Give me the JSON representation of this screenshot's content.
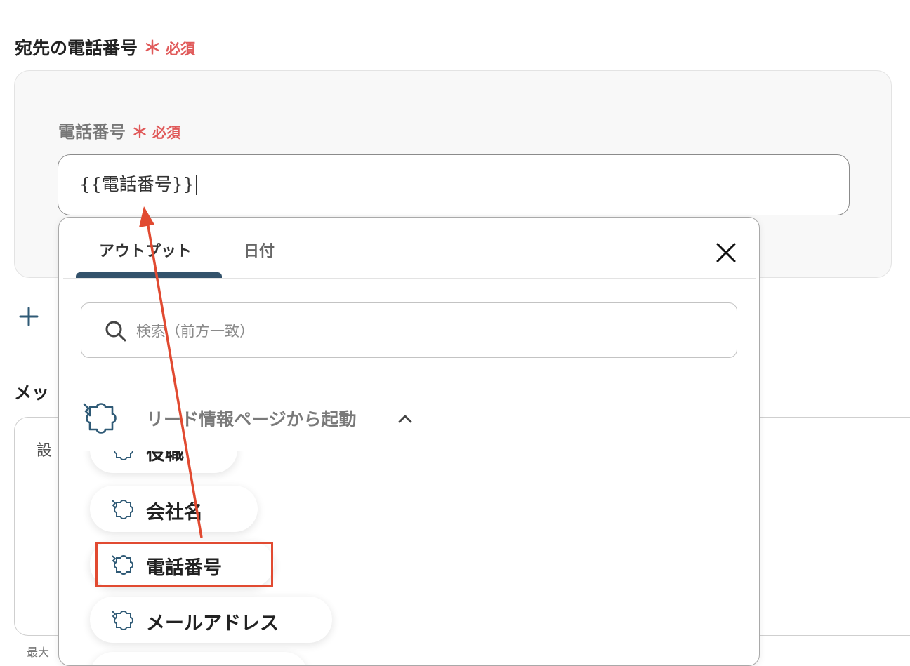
{
  "section": {
    "title": "宛先の電話番号",
    "star": "＊",
    "required": "必須"
  },
  "field": {
    "label": "電話番号",
    "star": "＊",
    "required": "必須",
    "value": "{{電話番号}}"
  },
  "background": {
    "message_heading": "メッ",
    "message_placeholder": "設",
    "max_text": "最大"
  },
  "popup": {
    "tabs": [
      {
        "label": "アウトプット"
      },
      {
        "label": "日付"
      }
    ],
    "search": {
      "placeholder": "検索（前方一致）"
    },
    "group": {
      "label": "リード情報ページから起動"
    },
    "items": [
      {
        "label": "役職"
      },
      {
        "label": "会社名"
      },
      {
        "label": "電話番号"
      },
      {
        "label": "メールアドレス"
      }
    ]
  },
  "colors": {
    "required": "#e05a5a",
    "tab_underline": "#33526b",
    "annotation": "#e14a31",
    "icon_stroke": "#2f5a76"
  },
  "icons": [
    "plus-icon",
    "close-icon",
    "search-icon",
    "puzzle-icon",
    "chevron-up-icon"
  ]
}
